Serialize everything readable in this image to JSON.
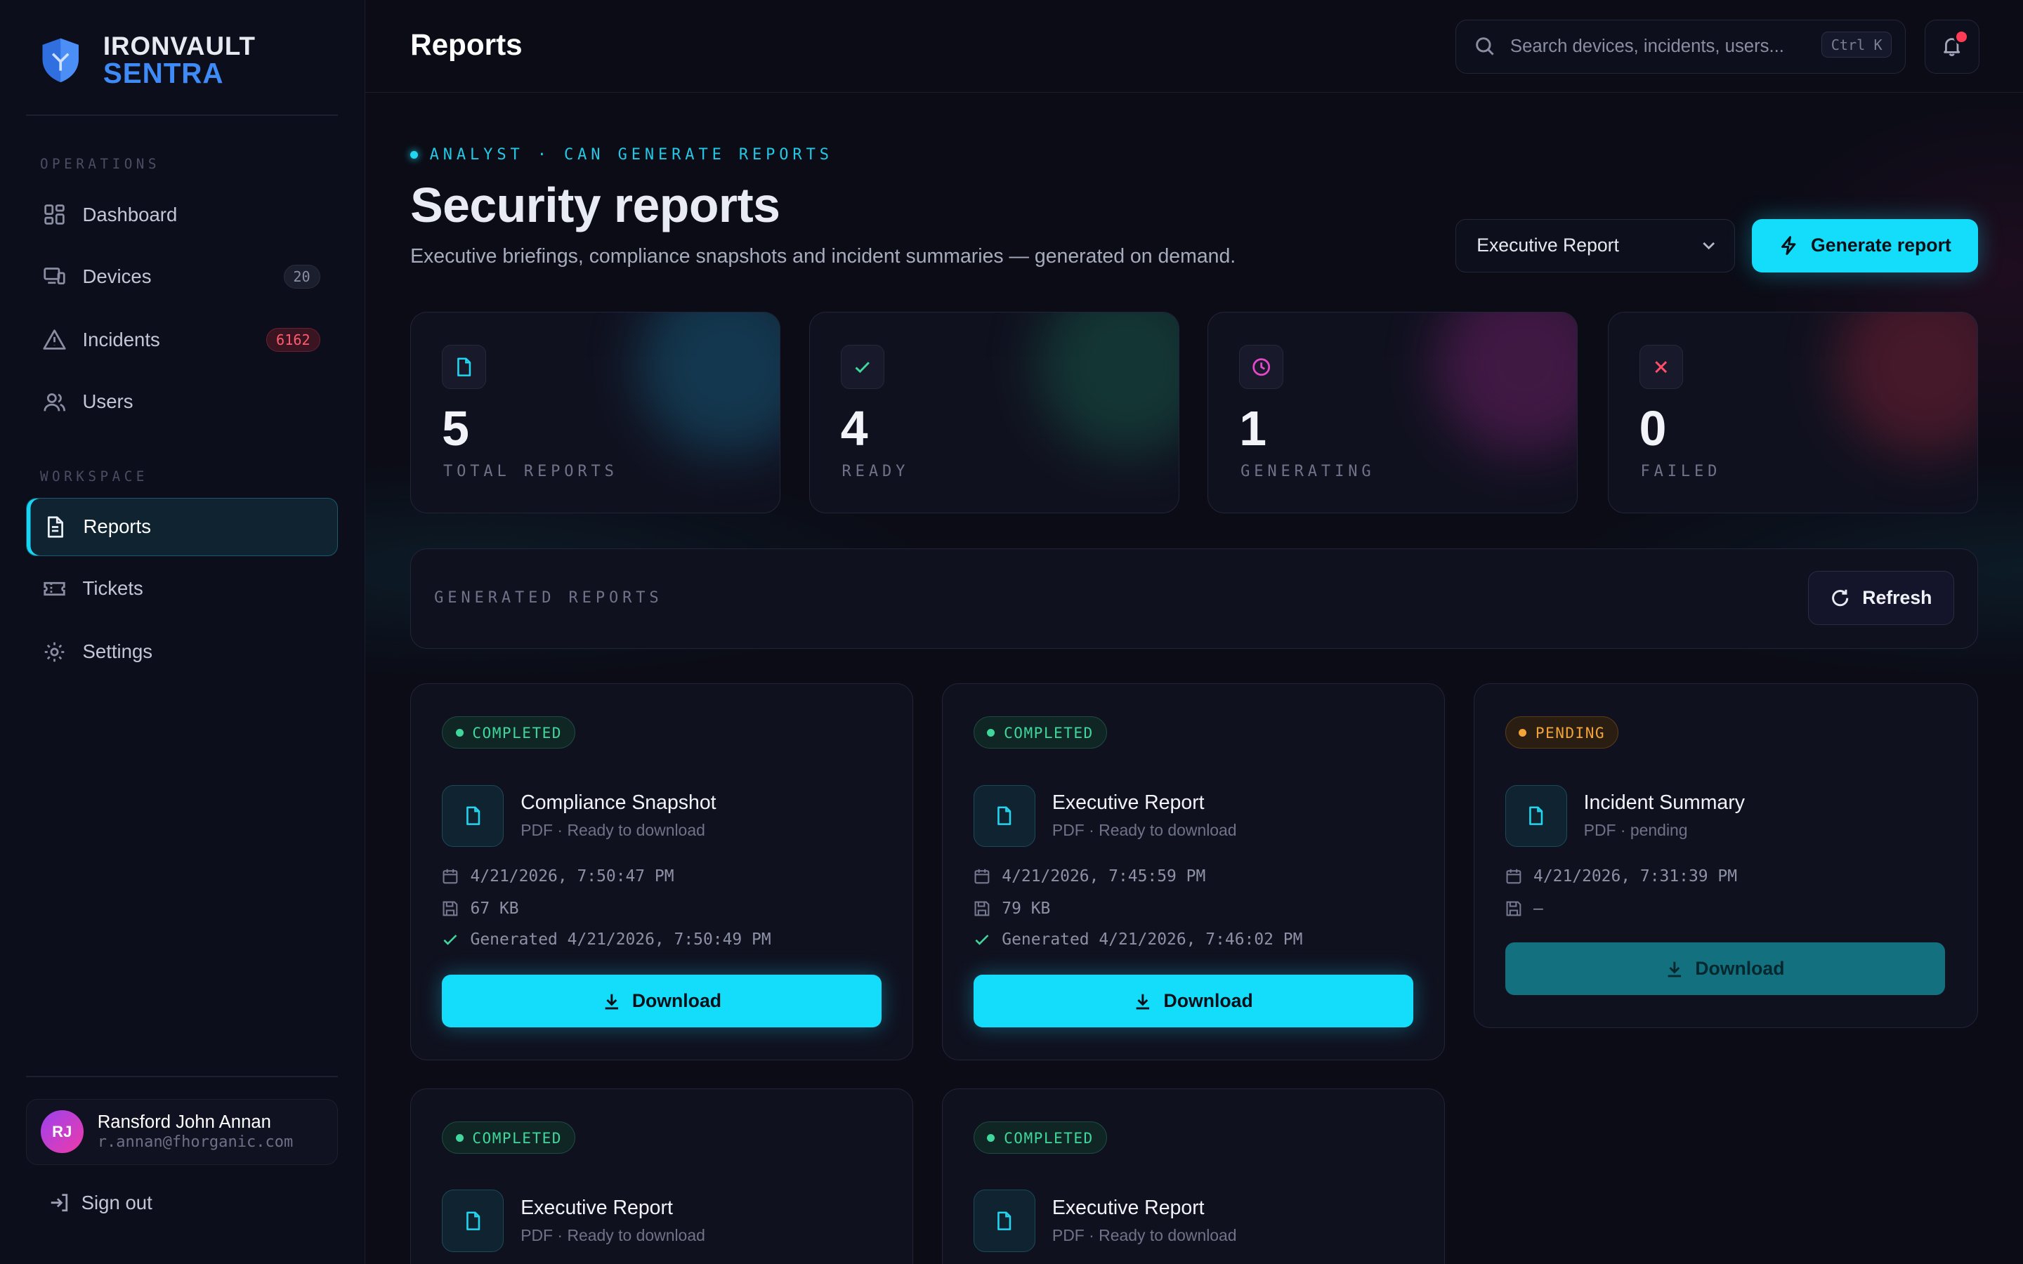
{
  "brand": {
    "line1": "IRONVAULT",
    "line2": "SENTRA"
  },
  "sidebar": {
    "sections": [
      {
        "title": "OPERATIONS"
      },
      {
        "title": "WORKSPACE"
      }
    ],
    "items": [
      {
        "label": "Dashboard",
        "icon": "grid-icon"
      },
      {
        "label": "Devices",
        "icon": "devices-icon",
        "badge": "20"
      },
      {
        "label": "Incidents",
        "icon": "warning-icon",
        "badge": "6162"
      },
      {
        "label": "Users",
        "icon": "users-icon"
      },
      {
        "label": "Reports",
        "icon": "document-icon",
        "active": true
      },
      {
        "label": "Tickets",
        "icon": "ticket-icon"
      },
      {
        "label": "Settings",
        "icon": "gear-icon"
      }
    ],
    "user": {
      "initials": "RJ",
      "name": "Ransford John Annan",
      "email": "r.annan@fhorganic.com"
    },
    "signout_label": "Sign out"
  },
  "header": {
    "title": "Reports",
    "search_placeholder": "Search devices, incidents, users...",
    "search_shortcut": "Ctrl K"
  },
  "hero": {
    "kicker": "ANALYST · CAN GENERATE REPORTS",
    "title": "Security reports",
    "subtitle": "Executive briefings, compliance snapshots and incident summaries — generated on demand.",
    "report_type_selected": "Executive Report",
    "generate_label": "Generate report"
  },
  "stats": [
    {
      "value": "5",
      "label": "TOTAL REPORTS",
      "icon": "document-icon",
      "color": "#22d5f0"
    },
    {
      "value": "4",
      "label": "READY",
      "icon": "check-icon",
      "color": "#3fd79c"
    },
    {
      "value": "1",
      "label": "GENERATING",
      "icon": "clock-icon",
      "color": "#e548c8"
    },
    {
      "value": "0",
      "label": "FAILED",
      "icon": "x-icon",
      "color": "#ff4d6a"
    }
  ],
  "generated": {
    "label": "GENERATED REPORTS",
    "refresh_label": "Refresh"
  },
  "reports": [
    {
      "status": "COMPLETED",
      "title": "Compliance Snapshot",
      "subtitle": "PDF · Ready to download",
      "created": "4/21/2026, 7:50:47 PM",
      "size": "67 KB",
      "generated": "Generated 4/21/2026, 7:50:49 PM",
      "download_label": "Download"
    },
    {
      "status": "COMPLETED",
      "title": "Executive Report",
      "subtitle": "PDF · Ready to download",
      "created": "4/21/2026, 7:45:59 PM",
      "size": "79 KB",
      "generated": "Generated 4/21/2026, 7:46:02 PM",
      "download_label": "Download"
    },
    {
      "status": "PENDING",
      "title": "Incident Summary",
      "subtitle": "PDF · pending",
      "created": "4/21/2026, 7:31:39 PM",
      "size": "—",
      "download_label": "Download"
    },
    {
      "status": "COMPLETED",
      "title": "Executive Report",
      "subtitle": "PDF · Ready to download"
    },
    {
      "status": "COMPLETED",
      "title": "Executive Report",
      "subtitle": "PDF · Ready to download"
    }
  ],
  "colors": {
    "accent": "#14dcfb",
    "brand_blue": "#3e8af7",
    "success": "#3fd79c",
    "warning": "#f2a33a",
    "danger": "#ff4d6a"
  }
}
